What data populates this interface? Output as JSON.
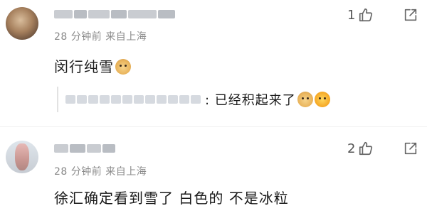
{
  "comments": [
    {
      "meta": "28 分钟前   来自上海",
      "text": "闵行纯雪",
      "likes": "1",
      "reply": {
        "text": ": 已经积起来了"
      }
    },
    {
      "meta": "28 分钟前   来自上海",
      "text": "徐汇确定看到雪了 白色的 不是冰粒",
      "likes": "2"
    }
  ]
}
